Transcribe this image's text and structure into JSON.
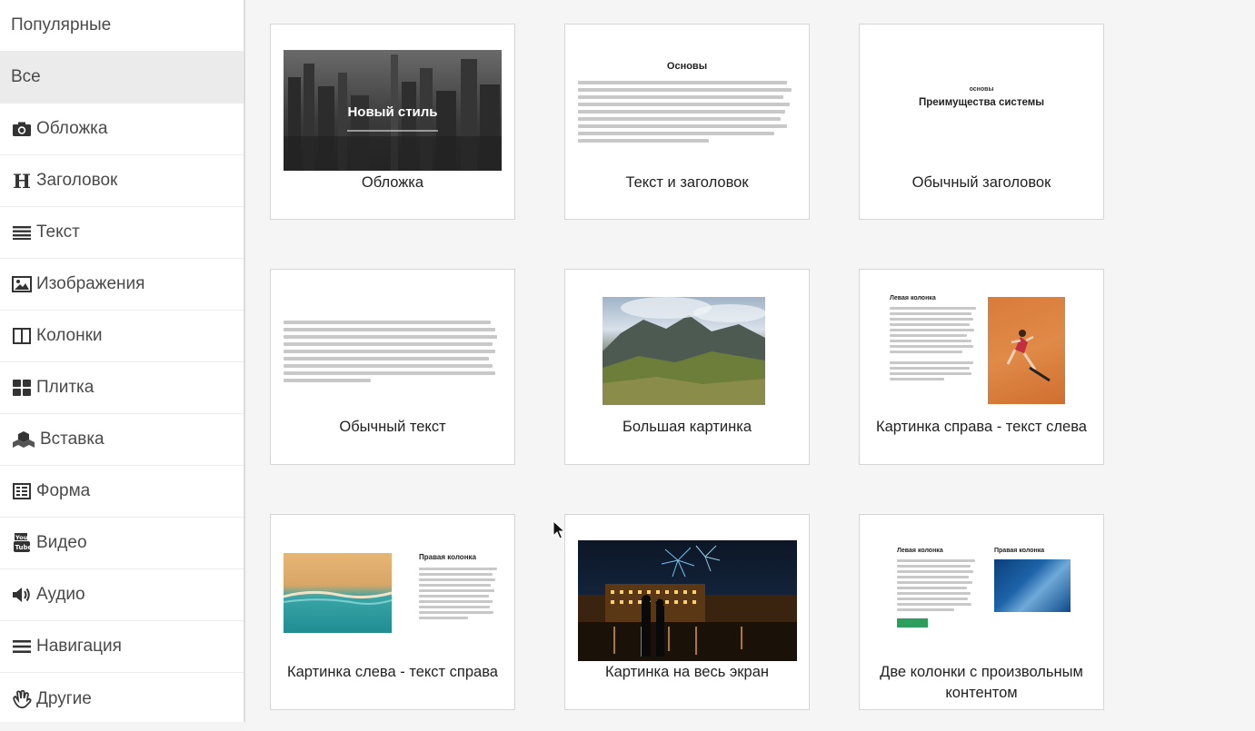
{
  "sidebar": {
    "items": [
      {
        "label": "Популярные",
        "icon": "none"
      },
      {
        "label": "Все",
        "icon": "none",
        "active": true
      },
      {
        "label": "Обложка",
        "icon": "camera-icon"
      },
      {
        "label": "Заголовок",
        "icon": "heading-icon"
      },
      {
        "label": "Текст",
        "icon": "text-lines-icon"
      },
      {
        "label": "Изображения",
        "icon": "image-icon"
      },
      {
        "label": "Колонки",
        "icon": "columns-icon"
      },
      {
        "label": "Плитка",
        "icon": "tiles-icon"
      },
      {
        "label": "Вставка",
        "icon": "cubes-icon"
      },
      {
        "label": "Форма",
        "icon": "form-icon"
      },
      {
        "label": "Видео",
        "icon": "youtube-icon"
      },
      {
        "label": "Аудио",
        "icon": "volume-icon"
      },
      {
        "label": "Навигация",
        "icon": "menu-icon"
      },
      {
        "label": "Другие",
        "icon": "hand-icon"
      }
    ]
  },
  "cards": [
    {
      "label": "Обложка",
      "preview_title": "Новый стиль"
    },
    {
      "label": "Текст и заголовок",
      "preview_title": "Основы"
    },
    {
      "label": "Обычный заголовок",
      "preview_kicker": "основы",
      "preview_title": "Преимущества системы"
    },
    {
      "label": "Обычный текст"
    },
    {
      "label": "Большая картинка"
    },
    {
      "label": "Картинка справа - текст слева",
      "preview_title": "Левая колонка"
    },
    {
      "label": "Картинка слева - текст справа",
      "preview_title": "Правая колонка"
    },
    {
      "label": "Картинка на весь экран"
    },
    {
      "label": "Две колонки с произвольным контентом",
      "preview_left": "Левая колонка",
      "preview_right": "Правая колонка"
    }
  ],
  "colors": {
    "sidebar_active": "#ebebeb",
    "button_green": "#2e9e5e"
  }
}
